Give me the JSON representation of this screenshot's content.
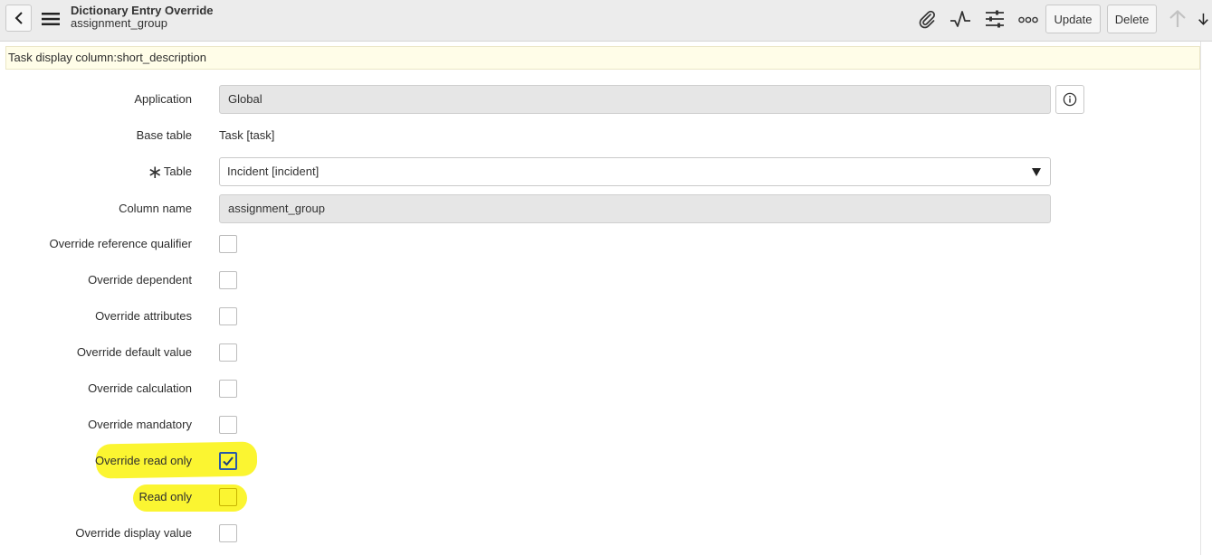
{
  "header": {
    "title": "Dictionary Entry Override",
    "subtitle": "assignment_group",
    "update_label": "Update",
    "delete_label": "Delete",
    "icons": [
      "back-icon",
      "menu-icon",
      "paperclip-icon",
      "activity-icon",
      "settings-sliders-icon",
      "more-icon",
      "arrow-up-icon",
      "arrow-down-icon"
    ]
  },
  "notice": {
    "text": "Task display column:short_description"
  },
  "form": {
    "application": {
      "label": "Application",
      "value": "Global"
    },
    "base_table": {
      "label": "Base table",
      "value": "Task [task]"
    },
    "table": {
      "label": "Table",
      "value": "Incident [incident]",
      "mandatory": true
    },
    "column_name": {
      "label": "Column name",
      "value": "assignment_group"
    },
    "checkboxes": [
      {
        "label": "Override reference qualifier",
        "checked": false
      },
      {
        "label": "Override dependent",
        "checked": false
      },
      {
        "label": "Override attributes",
        "checked": false
      },
      {
        "label": "Override default value",
        "checked": false
      },
      {
        "label": "Override calculation",
        "checked": false
      },
      {
        "label": "Override mandatory",
        "checked": false
      },
      {
        "label": "Override read only",
        "checked": true
      },
      {
        "label": "Read only",
        "checked": false
      },
      {
        "label": "Override display value",
        "checked": false
      }
    ]
  },
  "colors": {
    "highlight": "#fbf531",
    "header_bg": "#ececec",
    "notice_bg": "#fffde8",
    "checkbox_checked_border": "#2a5aa8"
  }
}
